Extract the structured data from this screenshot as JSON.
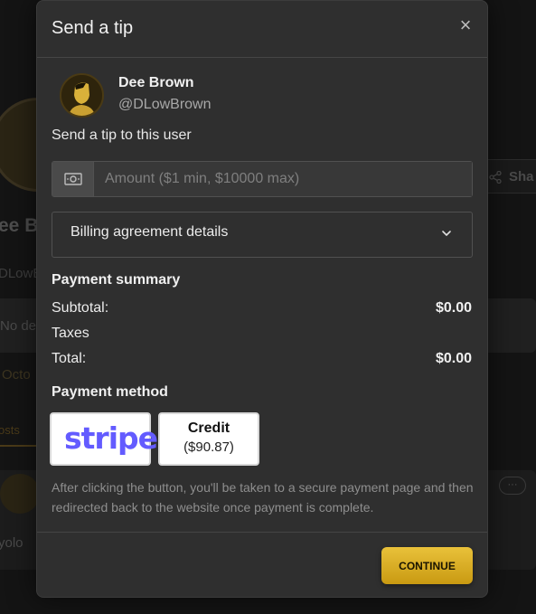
{
  "background": {
    "profile_name_fragment": "ee B",
    "handle_fragment": "DLowB",
    "description_fragment": "No de",
    "date_fragment": "Octo",
    "tab_fragment": "osts",
    "share_fragment": "Sha",
    "post_text_fragment": "yolo",
    "more_label": "···"
  },
  "modal": {
    "title": "Send a tip",
    "close_label": "×",
    "user": {
      "name": "Dee Brown",
      "handle": "@DLowBrown"
    },
    "prompt": "Send a tip to this user",
    "amount": {
      "placeholder": "Amount ($1 min, $10000 max)",
      "value": ""
    },
    "billing": {
      "label": "Billing agreement details"
    },
    "summary": {
      "title": "Payment summary",
      "rows": [
        {
          "label": "Subtotal:",
          "value": "$0.00"
        },
        {
          "label": "Taxes",
          "value": ""
        },
        {
          "label": "Total:",
          "value": "$0.00"
        }
      ]
    },
    "payment_method": {
      "title": "Payment method",
      "stripe_label": "stripe",
      "credit_label": "Credit",
      "credit_balance": "($90.87)"
    },
    "note": "After clicking the button, you'll be taken to a secure payment page and then redirected back to the website once payment is complete.",
    "continue_label": "CONTINUE"
  },
  "colors": {
    "accent": "#e0b42a",
    "stripe": "#635bff",
    "modal_bg": "#2f2f2f"
  },
  "icons": [
    "close-icon",
    "money-icon",
    "chevron-down-icon",
    "share-icon"
  ]
}
